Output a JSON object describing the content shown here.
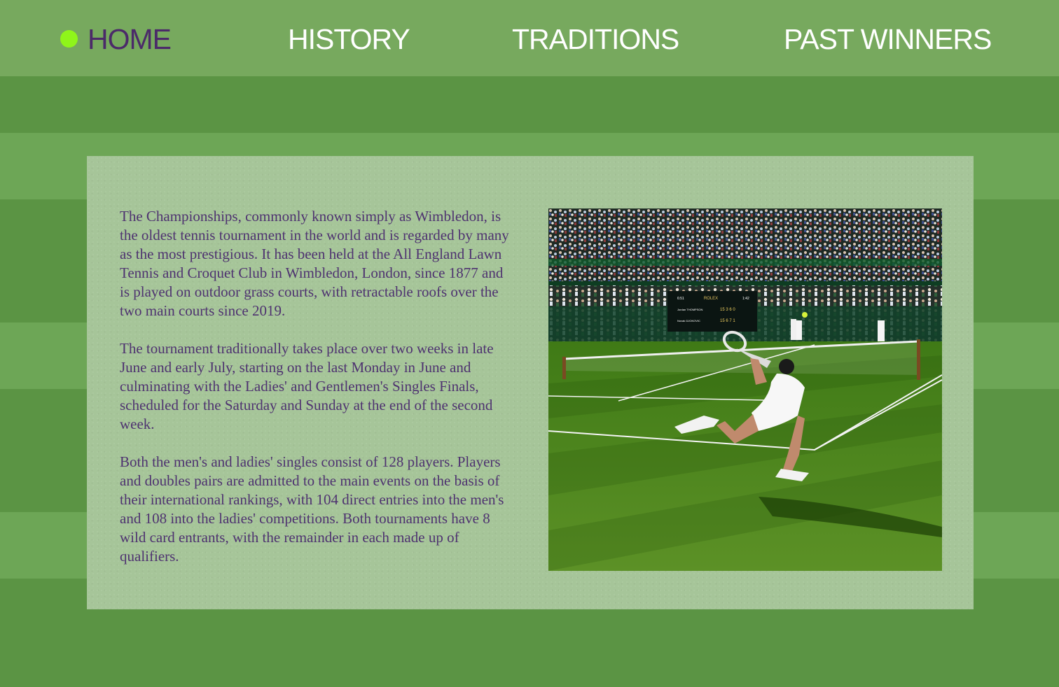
{
  "nav": {
    "items": [
      {
        "label": "HOME",
        "active": true
      },
      {
        "label": "HISTORY",
        "active": false
      },
      {
        "label": "TRADITIONS",
        "active": false
      },
      {
        "label": "PAST WINNERS",
        "active": false
      }
    ],
    "active_indicator_color": "#8ff51a"
  },
  "colors": {
    "nav_bg": "#77a95e",
    "text_purple": "#4e3270",
    "panel_bg": "#a6c599",
    "grass_dark": "#5b9444",
    "grass_light": "#6da656"
  },
  "content": {
    "paragraphs": [
      "The Championships, commonly known simply as Wimbledon, is the oldest tennis tournament in the world and is regarded by many as the most prestigious. It has been held at the All England Lawn Tennis and Croquet Club in Wimbledon, London, since 1877 and is played on outdoor grass courts, with retractable roofs over the two main courts since 2019.",
      "The tournament traditionally takes place over two weeks in late June and early July, starting on the last Monday in June and culminating with the Ladies' and Gentlemen's Singles Finals, scheduled for the Saturday and Sunday at the end of the second week.",
      "Both the men's and ladies' singles consist of 128 players. Players and doubles pairs are admitted to the main events on the basis of their international rankings, with 104 direct entries into the men's and 108 into the ladies' competitions. Both tournaments have 8 wild card entrants, with the remainder in each made up of qualifiers."
    ]
  },
  "photo": {
    "scoreboard": {
      "brand": "ROLEX",
      "time_left": "6:51",
      "time_right": "1:42",
      "player1": "Jordan THOMPSON",
      "player1_scores": "15 3 6 0",
      "player2": "Novak DJOKOVIC",
      "player2_scores": "15 6 7 1"
    }
  }
}
